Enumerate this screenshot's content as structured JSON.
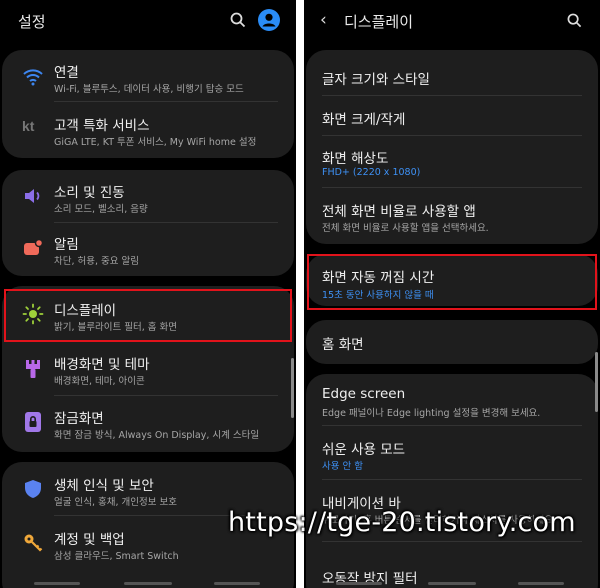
{
  "left": {
    "title": "설정",
    "groups": [
      [
        {
          "icon": "wifi-icon",
          "title": "연결",
          "subtitle": "Wi-Fi, 블루투스, 데이터 사용, 비행기 탑승 모드"
        },
        {
          "icon": "kt-icon",
          "icon_text": "kt",
          "title": "고객 특화 서비스",
          "subtitle": "GiGA LTE, KT 투폰 서비스, My WiFi home 설정"
        }
      ],
      [
        {
          "icon": "sound-icon",
          "title": "소리 및 진동",
          "subtitle": "소리 모드, 벨소리, 음량"
        },
        {
          "icon": "notification-icon",
          "title": "알림",
          "subtitle": "차단, 허용, 중요 알림"
        }
      ],
      [
        {
          "icon": "display-icon",
          "title": "디스플레이",
          "subtitle": "밝기, 블루라이트 필터, 홈 화면"
        },
        {
          "icon": "wallpaper-icon",
          "title": "배경화면 및 테마",
          "subtitle": "배경화면, 테마, 아이콘"
        },
        {
          "icon": "lockscreen-icon",
          "title": "잠금화면",
          "subtitle": "화면 잠금 방식, Always On Display, 시계 스타일"
        }
      ],
      [
        {
          "icon": "biometrics-icon",
          "title": "생체 인식 및 보안",
          "subtitle": "얼굴 인식, 홍채, 개인정보 보호"
        },
        {
          "icon": "accounts-icon",
          "title": "계정 및 백업",
          "subtitle": "삼성 클라우드, Smart Switch"
        }
      ]
    ]
  },
  "right": {
    "title": "디스플레이",
    "items": [
      {
        "title": "글자 크기와 스타일",
        "subtitle": ""
      },
      {
        "title": "화면 크게/작게",
        "subtitle": ""
      },
      {
        "title": "화면 해상도",
        "subtitle": "FHD+ (2220 x 1080)"
      },
      {
        "title": "전체 화면 비율로 사용할 앱",
        "subtitle": "전체 화면 비율로 사용할 앱을 선택하세요."
      },
      {
        "title": "화면 자동 꺼짐 시간",
        "subtitle": "15초 동안 사용하지 않을 때"
      },
      {
        "title": "홈 화면",
        "subtitle": ""
      },
      {
        "title": "Edge screen",
        "subtitle": "Edge 패널이나 Edge lighting 설정을 변경해 보세요."
      },
      {
        "title": "쉬운 사용 모드",
        "subtitle": "사용 안 함"
      },
      {
        "title": "내비게이션 바",
        "subtitle": "뒤로가기, 홈 버튼 순서를 관리하거나 제스처를 사용하세요."
      },
      {
        "title": "오동작 방지 필터",
        "subtitle": ""
      }
    ]
  },
  "watermark": "https://tge-20.tistory.com",
  "colors": {
    "highlight": "#e2131b",
    "accent_blue": "#3e91f5",
    "card": "#1e1e1e"
  }
}
